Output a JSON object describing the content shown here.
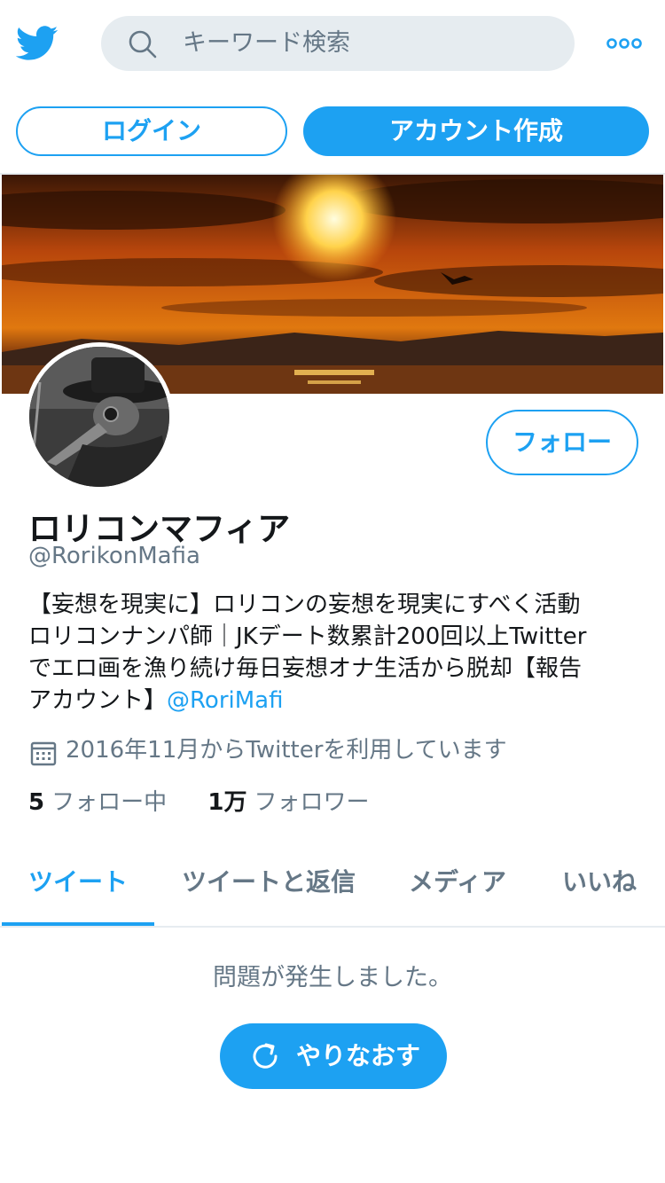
{
  "topbar": {
    "search_placeholder": "キーワード検索"
  },
  "auth": {
    "login_label": "ログイン",
    "signup_label": "アカウント作成"
  },
  "profile": {
    "follow_label": "フォロー",
    "name": "ロリコンマフィア",
    "handle": "@RorikonMafia",
    "bio": {
      "line1": "【妄想を現実に】ロリコンの妄想を現実にすべく活動",
      "line2": "ロリコンナンパ師｜JKデート数累計200回以上Twitter",
      "line3": "でエロ画を漁り続け毎日妄想オナ生活から脱却【報告",
      "line4_prefix": "アカウント】",
      "line4_mention": "@RoriMafi"
    },
    "joined": "2016年11月からTwitterを利用しています",
    "following_count": "5",
    "following_label": "フォロー中",
    "followers_count": "1万",
    "followers_label": "フォロワー"
  },
  "tabs": [
    {
      "label": "ツイート",
      "active": true
    },
    {
      "label": "ツイートと返信",
      "active": false
    },
    {
      "label": "メディア",
      "active": false
    },
    {
      "label": "いいね",
      "active": false
    }
  ],
  "feed": {
    "error_message": "問題が発生しました。",
    "retry_label": "やりなおす"
  },
  "colors": {
    "accent": "#1da1f2",
    "secondary_text": "#657786",
    "primary_text": "#14171a",
    "search_bg": "#e6ecf0"
  },
  "icons": {
    "logo": "twitter-bird-icon",
    "search": "search-icon",
    "more": "more-dots-icon",
    "calendar": "calendar-icon",
    "retry": "refresh-icon"
  }
}
